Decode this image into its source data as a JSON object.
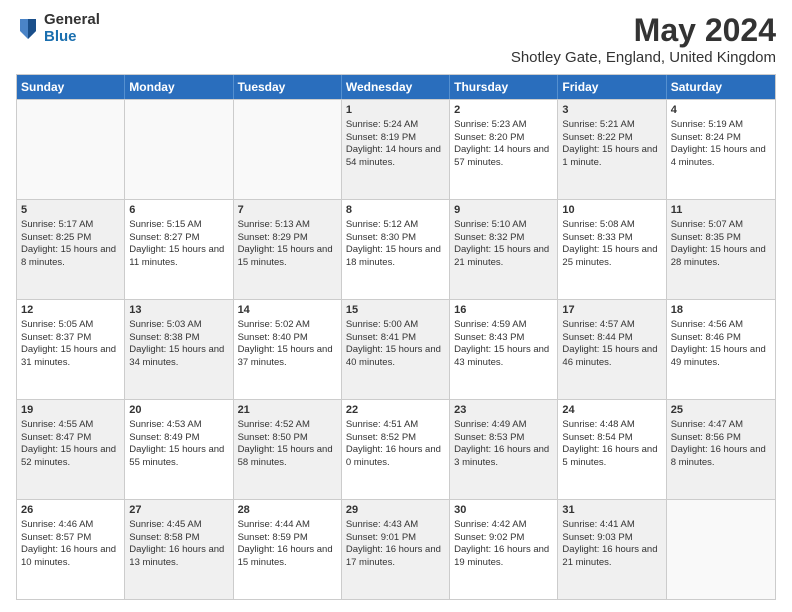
{
  "header": {
    "logo": {
      "general": "General",
      "blue": "Blue"
    },
    "title": "May 2024",
    "location": "Shotley Gate, England, United Kingdom"
  },
  "weekdays": [
    "Sunday",
    "Monday",
    "Tuesday",
    "Wednesday",
    "Thursday",
    "Friday",
    "Saturday"
  ],
  "rows": [
    [
      {
        "day": "",
        "sunrise": "",
        "sunset": "",
        "daylight": "",
        "shaded": false,
        "empty": true
      },
      {
        "day": "",
        "sunrise": "",
        "sunset": "",
        "daylight": "",
        "shaded": false,
        "empty": true
      },
      {
        "day": "",
        "sunrise": "",
        "sunset": "",
        "daylight": "",
        "shaded": false,
        "empty": true
      },
      {
        "day": "1",
        "sunrise": "Sunrise: 5:24 AM",
        "sunset": "Sunset: 8:19 PM",
        "daylight": "Daylight: 14 hours and 54 minutes.",
        "shaded": true
      },
      {
        "day": "2",
        "sunrise": "Sunrise: 5:23 AM",
        "sunset": "Sunset: 8:20 PM",
        "daylight": "Daylight: 14 hours and 57 minutes.",
        "shaded": false
      },
      {
        "day": "3",
        "sunrise": "Sunrise: 5:21 AM",
        "sunset": "Sunset: 8:22 PM",
        "daylight": "Daylight: 15 hours and 1 minute.",
        "shaded": true
      },
      {
        "day": "4",
        "sunrise": "Sunrise: 5:19 AM",
        "sunset": "Sunset: 8:24 PM",
        "daylight": "Daylight: 15 hours and 4 minutes.",
        "shaded": false
      }
    ],
    [
      {
        "day": "5",
        "sunrise": "Sunrise: 5:17 AM",
        "sunset": "Sunset: 8:25 PM",
        "daylight": "Daylight: 15 hours and 8 minutes.",
        "shaded": true
      },
      {
        "day": "6",
        "sunrise": "Sunrise: 5:15 AM",
        "sunset": "Sunset: 8:27 PM",
        "daylight": "Daylight: 15 hours and 11 minutes.",
        "shaded": false
      },
      {
        "day": "7",
        "sunrise": "Sunrise: 5:13 AM",
        "sunset": "Sunset: 8:29 PM",
        "daylight": "Daylight: 15 hours and 15 minutes.",
        "shaded": true
      },
      {
        "day": "8",
        "sunrise": "Sunrise: 5:12 AM",
        "sunset": "Sunset: 8:30 PM",
        "daylight": "Daylight: 15 hours and 18 minutes.",
        "shaded": false
      },
      {
        "day": "9",
        "sunrise": "Sunrise: 5:10 AM",
        "sunset": "Sunset: 8:32 PM",
        "daylight": "Daylight: 15 hours and 21 minutes.",
        "shaded": true
      },
      {
        "day": "10",
        "sunrise": "Sunrise: 5:08 AM",
        "sunset": "Sunset: 8:33 PM",
        "daylight": "Daylight: 15 hours and 25 minutes.",
        "shaded": false
      },
      {
        "day": "11",
        "sunrise": "Sunrise: 5:07 AM",
        "sunset": "Sunset: 8:35 PM",
        "daylight": "Daylight: 15 hours and 28 minutes.",
        "shaded": true
      }
    ],
    [
      {
        "day": "12",
        "sunrise": "Sunrise: 5:05 AM",
        "sunset": "Sunset: 8:37 PM",
        "daylight": "Daylight: 15 hours and 31 minutes.",
        "shaded": false
      },
      {
        "day": "13",
        "sunrise": "Sunrise: 5:03 AM",
        "sunset": "Sunset: 8:38 PM",
        "daylight": "Daylight: 15 hours and 34 minutes.",
        "shaded": true
      },
      {
        "day": "14",
        "sunrise": "Sunrise: 5:02 AM",
        "sunset": "Sunset: 8:40 PM",
        "daylight": "Daylight: 15 hours and 37 minutes.",
        "shaded": false
      },
      {
        "day": "15",
        "sunrise": "Sunrise: 5:00 AM",
        "sunset": "Sunset: 8:41 PM",
        "daylight": "Daylight: 15 hours and 40 minutes.",
        "shaded": true
      },
      {
        "day": "16",
        "sunrise": "Sunrise: 4:59 AM",
        "sunset": "Sunset: 8:43 PM",
        "daylight": "Daylight: 15 hours and 43 minutes.",
        "shaded": false
      },
      {
        "day": "17",
        "sunrise": "Sunrise: 4:57 AM",
        "sunset": "Sunset: 8:44 PM",
        "daylight": "Daylight: 15 hours and 46 minutes.",
        "shaded": true
      },
      {
        "day": "18",
        "sunrise": "Sunrise: 4:56 AM",
        "sunset": "Sunset: 8:46 PM",
        "daylight": "Daylight: 15 hours and 49 minutes.",
        "shaded": false
      }
    ],
    [
      {
        "day": "19",
        "sunrise": "Sunrise: 4:55 AM",
        "sunset": "Sunset: 8:47 PM",
        "daylight": "Daylight: 15 hours and 52 minutes.",
        "shaded": true
      },
      {
        "day": "20",
        "sunrise": "Sunrise: 4:53 AM",
        "sunset": "Sunset: 8:49 PM",
        "daylight": "Daylight: 15 hours and 55 minutes.",
        "shaded": false
      },
      {
        "day": "21",
        "sunrise": "Sunrise: 4:52 AM",
        "sunset": "Sunset: 8:50 PM",
        "daylight": "Daylight: 15 hours and 58 minutes.",
        "shaded": true
      },
      {
        "day": "22",
        "sunrise": "Sunrise: 4:51 AM",
        "sunset": "Sunset: 8:52 PM",
        "daylight": "Daylight: 16 hours and 0 minutes.",
        "shaded": false
      },
      {
        "day": "23",
        "sunrise": "Sunrise: 4:49 AM",
        "sunset": "Sunset: 8:53 PM",
        "daylight": "Daylight: 16 hours and 3 minutes.",
        "shaded": true
      },
      {
        "day": "24",
        "sunrise": "Sunrise: 4:48 AM",
        "sunset": "Sunset: 8:54 PM",
        "daylight": "Daylight: 16 hours and 5 minutes.",
        "shaded": false
      },
      {
        "day": "25",
        "sunrise": "Sunrise: 4:47 AM",
        "sunset": "Sunset: 8:56 PM",
        "daylight": "Daylight: 16 hours and 8 minutes.",
        "shaded": true
      }
    ],
    [
      {
        "day": "26",
        "sunrise": "Sunrise: 4:46 AM",
        "sunset": "Sunset: 8:57 PM",
        "daylight": "Daylight: 16 hours and 10 minutes.",
        "shaded": false
      },
      {
        "day": "27",
        "sunrise": "Sunrise: 4:45 AM",
        "sunset": "Sunset: 8:58 PM",
        "daylight": "Daylight: 16 hours and 13 minutes.",
        "shaded": true
      },
      {
        "day": "28",
        "sunrise": "Sunrise: 4:44 AM",
        "sunset": "Sunset: 8:59 PM",
        "daylight": "Daylight: 16 hours and 15 minutes.",
        "shaded": false
      },
      {
        "day": "29",
        "sunrise": "Sunrise: 4:43 AM",
        "sunset": "Sunset: 9:01 PM",
        "daylight": "Daylight: 16 hours and 17 minutes.",
        "shaded": true
      },
      {
        "day": "30",
        "sunrise": "Sunrise: 4:42 AM",
        "sunset": "Sunset: 9:02 PM",
        "daylight": "Daylight: 16 hours and 19 minutes.",
        "shaded": false
      },
      {
        "day": "31",
        "sunrise": "Sunrise: 4:41 AM",
        "sunset": "Sunset: 9:03 PM",
        "daylight": "Daylight: 16 hours and 21 minutes.",
        "shaded": true
      },
      {
        "day": "",
        "sunrise": "",
        "sunset": "",
        "daylight": "",
        "shaded": false,
        "empty": true
      }
    ]
  ]
}
